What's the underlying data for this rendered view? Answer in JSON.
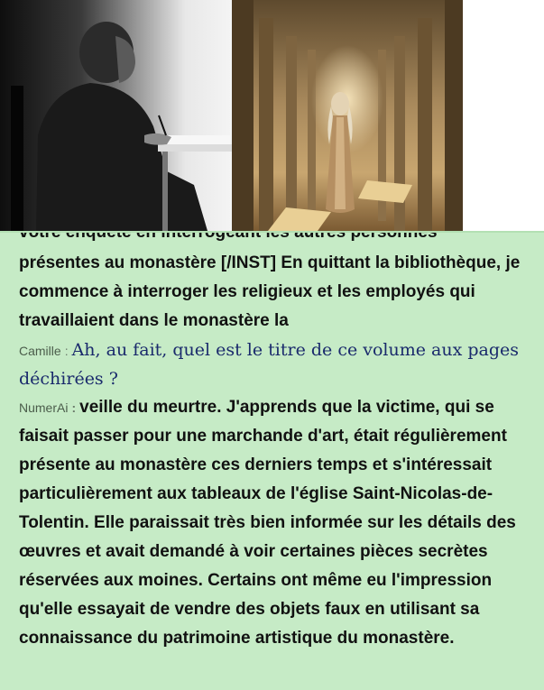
{
  "images": [
    {
      "name": "monk-writing-image"
    },
    {
      "name": "ghost-woman-corridor-image"
    }
  ],
  "chat": {
    "cut_text": "votre enquête en interrogeant les autres personnes",
    "first_ai_text": "présentes au monastère [/INST] En quittant la bibliothèque, je commence à interroger les religieux et les employés qui travaillaient dans le monastère la",
    "separator": ":",
    "messages": [
      {
        "speaker": "Camille",
        "text": "Ah, au fait, quel est le titre de ce volume aux pages déchirées ?"
      },
      {
        "speaker": "NumerAi",
        "text": "veille du meurtre. J'apprends que la victime, qui se faisait passer pour une marchande d'art, était régulièrement présente au monastère ces derniers temps et s'intéressait particulièrement aux tableaux de l'église Saint-Nicolas-de-Tolentin. Elle paraissait très bien informée sur les détails des œuvres et avait demandé à voir certaines pièces secrètes réservées aux moines. Certains ont même eu l'impression qu'elle essayait de vendre des objets faux en utilisant sa connaissance du patrimoine artistique du monastère."
      }
    ]
  }
}
